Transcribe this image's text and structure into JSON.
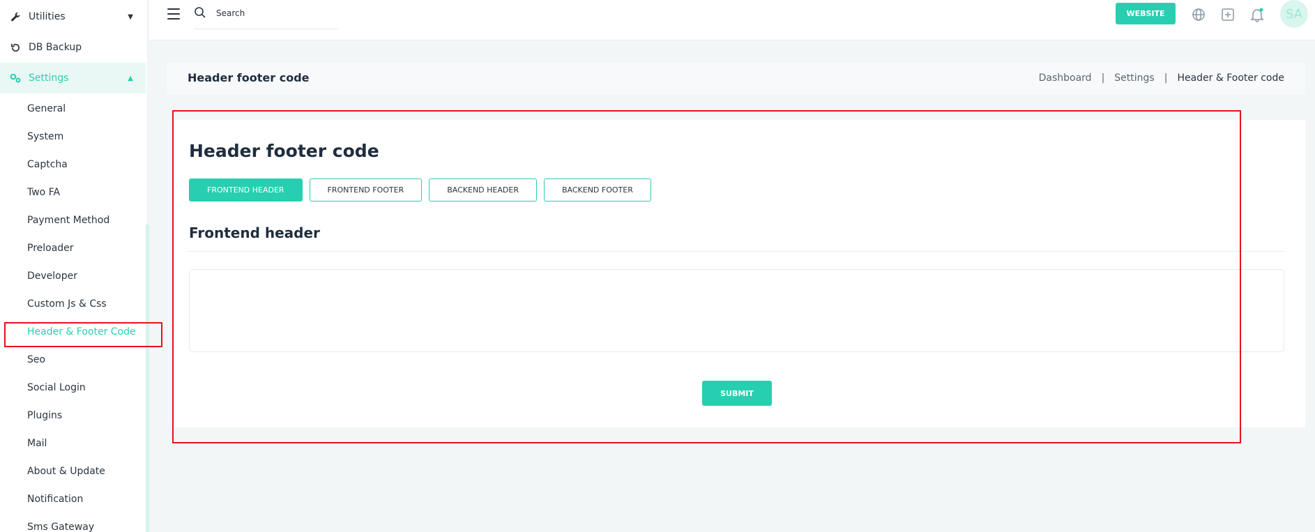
{
  "colors": {
    "accent": "#27cfb0",
    "highlight": "#e8101f"
  },
  "sidebar": {
    "top_items": [
      {
        "label": "Utilities",
        "icon": "wrench-icon"
      },
      {
        "label": "DB Backup",
        "icon": "restore-icon"
      },
      {
        "label": "Settings",
        "icon": "gears-icon"
      }
    ],
    "sub_items": [
      {
        "label": "General"
      },
      {
        "label": "System"
      },
      {
        "label": "Captcha"
      },
      {
        "label": "Two FA"
      },
      {
        "label": "Payment Method"
      },
      {
        "label": "Preloader"
      },
      {
        "label": "Developer"
      },
      {
        "label": "Custom Js & Css"
      },
      {
        "label": "Header & Footer Code"
      },
      {
        "label": "Seo"
      },
      {
        "label": "Social Login"
      },
      {
        "label": "Plugins"
      },
      {
        "label": "Mail"
      },
      {
        "label": "About & Update"
      },
      {
        "label": "Notification"
      },
      {
        "label": "Sms Gateway"
      }
    ]
  },
  "topbar": {
    "search_placeholder": "Search",
    "website_label": "WEBSITE",
    "icons": [
      "globe-icon",
      "plus-square-icon",
      "bell-icon"
    ],
    "avatar_initials": "SA"
  },
  "breadcrumb": {
    "title": "Header footer code",
    "items": [
      "Dashboard",
      "Settings",
      "Header & Footer code"
    ]
  },
  "card": {
    "title": "Header footer code",
    "tabs": [
      "FRONTEND HEADER",
      "FRONTEND FOOTER",
      "BACKEND HEADER",
      "BACKEND FOOTER"
    ],
    "active_tab": "FRONTEND HEADER",
    "section_title": "Frontend header",
    "code_value": "",
    "submit_label": "SUBMIT"
  }
}
